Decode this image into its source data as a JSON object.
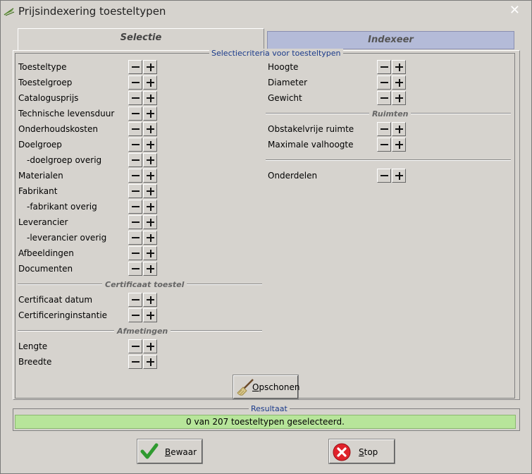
{
  "window": {
    "title": "Prijsindexering toesteltypen",
    "close_glyph": "✕"
  },
  "tabs": [
    {
      "label": "Selectie"
    },
    {
      "label": "Indexeer"
    }
  ],
  "selection_group": {
    "title": "Selectiecriteria voor toesteltypen"
  },
  "left_items": [
    {
      "label": "Toesteltype"
    },
    {
      "label": "Toestelgroep"
    },
    {
      "label": "Catalogusprijs"
    },
    {
      "label": "Technische levensduur"
    },
    {
      "label": "Onderhoudskosten"
    },
    {
      "label": "Doelgroep"
    },
    {
      "label": "-doelgroep overig"
    },
    {
      "label": "Materialen"
    },
    {
      "label": "Fabrikant"
    },
    {
      "label": "-fabrikant overig"
    },
    {
      "label": "Leverancier"
    },
    {
      "label": "-leverancier overig"
    },
    {
      "label": "Afbeeldingen"
    },
    {
      "label": "Documenten"
    }
  ],
  "certificaat": {
    "title": "Certificaat toestel",
    "items": [
      {
        "label": "Certificaat datum"
      },
      {
        "label": "Certificeringinstantie"
      }
    ]
  },
  "afmetingen": {
    "title": "Afmetingen",
    "items": [
      {
        "label": "Lengte"
      },
      {
        "label": "Breedte"
      }
    ]
  },
  "right_items": [
    {
      "label": "Hoogte"
    },
    {
      "label": "Diameter"
    },
    {
      "label": "Gewicht"
    }
  ],
  "ruimten": {
    "title": "Ruimten",
    "items": [
      {
        "label": "Obstakelvrije ruimte"
      },
      {
        "label": "Maximale valhoogte"
      }
    ]
  },
  "onderdelen": {
    "label": "Onderdelen"
  },
  "clear_button": {
    "label_first": "O",
    "label_rest": "pschonen"
  },
  "result": {
    "title": "Resultaat",
    "text": "0 van 207 toesteltypen geselecteerd."
  },
  "save_button": {
    "label_first": "B",
    "label_rest": "ewaar"
  },
  "stop_button": {
    "label_first": "S",
    "label_rest": "top"
  },
  "colors": {
    "result_bg": "#b7e59a",
    "inactive_tab": "#b4bbd8",
    "group_title": "#1a3a8a"
  }
}
